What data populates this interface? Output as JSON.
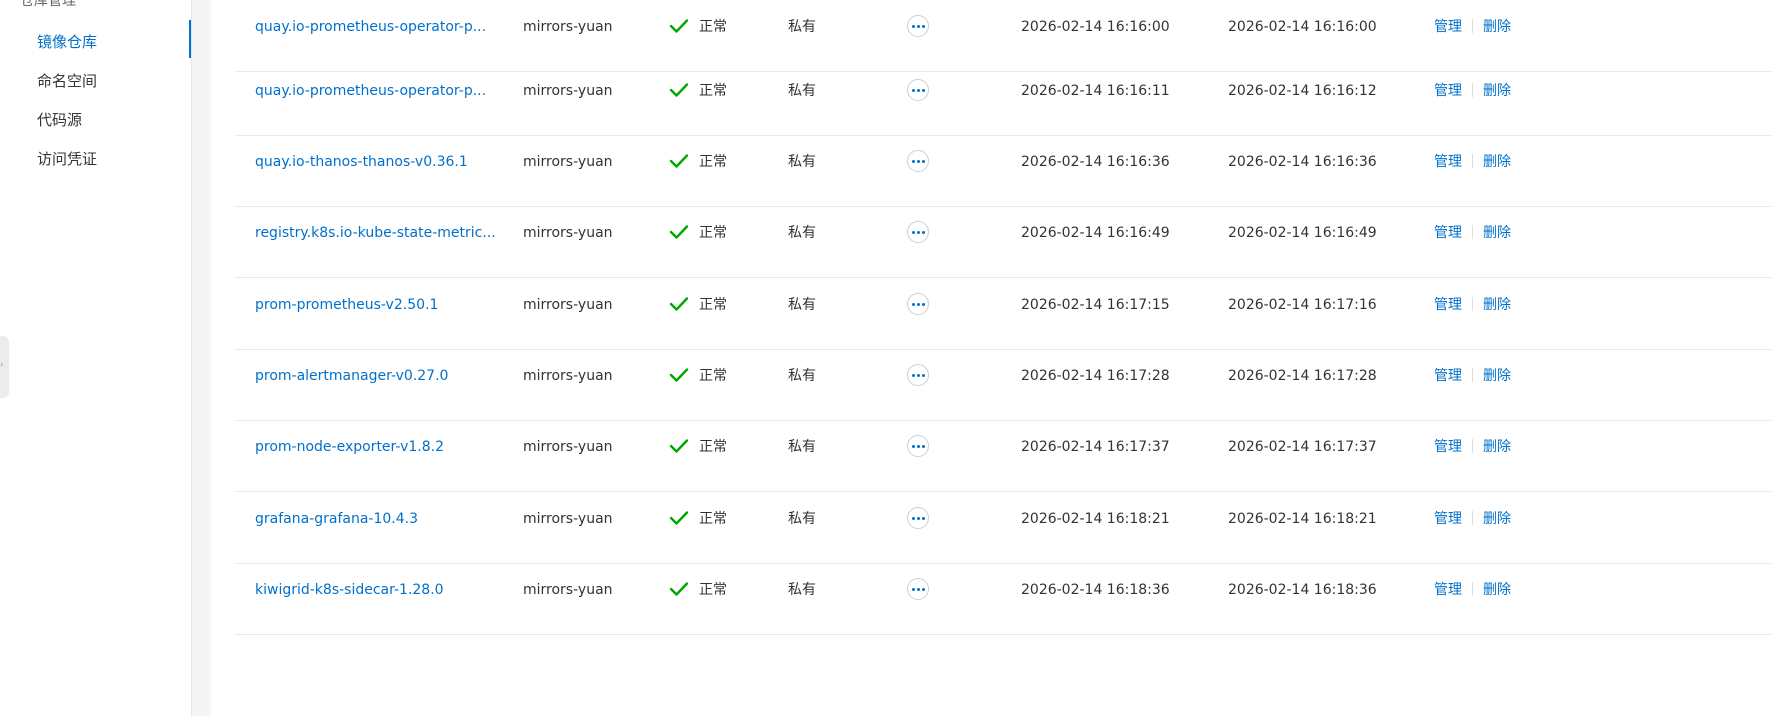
{
  "sidebar": {
    "group_label": "仓库管理",
    "toggle_icon": "chevron-up-icon",
    "items": [
      {
        "label": "镜像仓库",
        "active": true
      },
      {
        "label": "命名空间",
        "active": false
      },
      {
        "label": "代码源",
        "active": false
      },
      {
        "label": "访问凭证",
        "active": false
      }
    ]
  },
  "colors": {
    "accent": "#0070cc",
    "success": "#00a700",
    "text": "#333333",
    "border": "#e8e8e8"
  },
  "table": {
    "rows": [
      {
        "name": "quay.io-prometheus-operator-p...",
        "namespace": "mirrors-yuan",
        "status": "正常",
        "type": "私有",
        "created": "2026-02-14 16:16:00",
        "updated": "2026-02-14 16:16:00",
        "manage": "管理",
        "delete": "删除"
      },
      {
        "name": "quay.io-prometheus-operator-p...",
        "namespace": "mirrors-yuan",
        "status": "正常",
        "type": "私有",
        "created": "2026-02-14 16:16:11",
        "updated": "2026-02-14 16:16:12",
        "manage": "管理",
        "delete": "删除"
      },
      {
        "name": "quay.io-thanos-thanos-v0.36.1",
        "namespace": "mirrors-yuan",
        "status": "正常",
        "type": "私有",
        "created": "2026-02-14 16:16:36",
        "updated": "2026-02-14 16:16:36",
        "manage": "管理",
        "delete": "删除"
      },
      {
        "name": "registry.k8s.io-kube-state-metric...",
        "namespace": "mirrors-yuan",
        "status": "正常",
        "type": "私有",
        "created": "2026-02-14 16:16:49",
        "updated": "2026-02-14 16:16:49",
        "manage": "管理",
        "delete": "删除"
      },
      {
        "name": "prom-prometheus-v2.50.1",
        "namespace": "mirrors-yuan",
        "status": "正常",
        "type": "私有",
        "created": "2026-02-14 16:17:15",
        "updated": "2026-02-14 16:17:16",
        "manage": "管理",
        "delete": "删除"
      },
      {
        "name": "prom-alertmanager-v0.27.0",
        "namespace": "mirrors-yuan",
        "status": "正常",
        "type": "私有",
        "created": "2026-02-14 16:17:28",
        "updated": "2026-02-14 16:17:28",
        "manage": "管理",
        "delete": "删除"
      },
      {
        "name": "prom-node-exporter-v1.8.2",
        "namespace": "mirrors-yuan",
        "status": "正常",
        "type": "私有",
        "created": "2026-02-14 16:17:37",
        "updated": "2026-02-14 16:17:37",
        "manage": "管理",
        "delete": "删除"
      },
      {
        "name": "grafana-grafana-10.4.3",
        "namespace": "mirrors-yuan",
        "status": "正常",
        "type": "私有",
        "created": "2026-02-14 16:18:21",
        "updated": "2026-02-14 16:18:21",
        "manage": "管理",
        "delete": "删除"
      },
      {
        "name": "kiwigrid-k8s-sidecar-1.28.0",
        "namespace": "mirrors-yuan",
        "status": "正常",
        "type": "私有",
        "created": "2026-02-14 16:18:36",
        "updated": "2026-02-14 16:18:36",
        "manage": "管理",
        "delete": "删除"
      }
    ]
  }
}
